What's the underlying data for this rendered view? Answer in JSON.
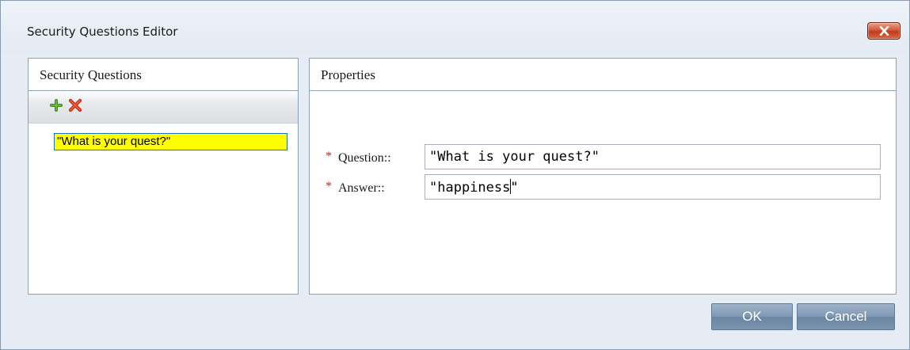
{
  "window": {
    "title": "Security Questions Editor"
  },
  "questions_panel": {
    "title": "Security Questions",
    "toolbar": {
      "add_icon": "plus-icon",
      "delete_icon": "x-icon",
      "add_color": "#4a9a2a",
      "delete_color": "#d8401e"
    },
    "items": [
      {
        "label": "\"What is your quest?\"",
        "selected": true
      }
    ]
  },
  "properties_panel": {
    "title": "Properties",
    "required_marker": "*",
    "fields": {
      "question": {
        "label": "Question::",
        "value": "\"What is your quest?\""
      },
      "answer": {
        "label": "Answer::",
        "value_before_caret": "\"happiness",
        "value_after_caret": "\""
      }
    }
  },
  "buttons": {
    "ok": "OK",
    "cancel": "Cancel"
  },
  "colors": {
    "selection_highlight": "#ffff00",
    "required": "#cc2020",
    "button_bg": "#7e98b3"
  }
}
